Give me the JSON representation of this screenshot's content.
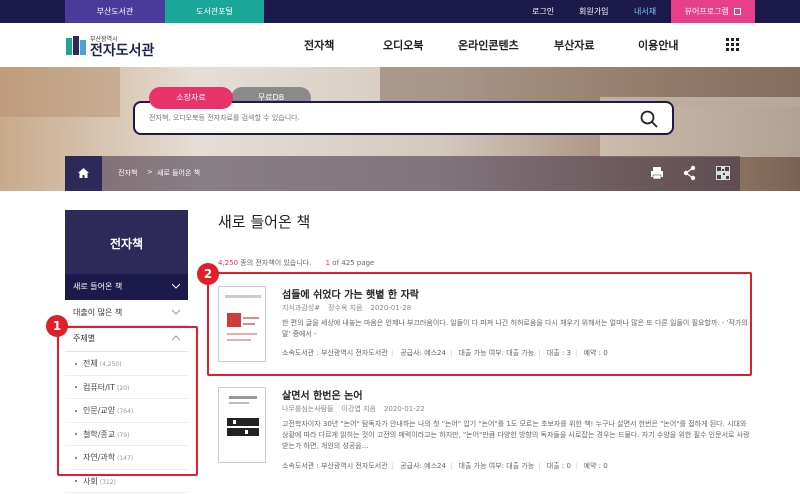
{
  "topbar": {
    "busan_tab": "부산도서관",
    "library_tab": "도서관포털",
    "login": "로그인",
    "join": "회원가입",
    "mylib": "내서재",
    "reader": "뷰어프로그램"
  },
  "logo": {
    "small": "부산광역시",
    "big": "전자도서관"
  },
  "gnb": [
    "전자책",
    "오디오북",
    "온라인콘텐츠",
    "부산자료",
    "이용안내"
  ],
  "search": {
    "tab_holdings": "소장자료",
    "tab_free": "무료DB",
    "placeholder": "전자책, 오디오북등 전자자료를 검색할 수 있습니다."
  },
  "breadcrumb": {
    "level1": "전자책",
    "sep": ">",
    "level2": "새로 들어온 책"
  },
  "sidebar": {
    "title": "전자책",
    "items": [
      {
        "label": "새로 들어온 책"
      },
      {
        "label": "대출이 많은 책"
      },
      {
        "label": "주제별"
      }
    ],
    "subjects": [
      {
        "label": "전체",
        "count": "(4,250)"
      },
      {
        "label": "컴퓨터/IT",
        "count": "(20)"
      },
      {
        "label": "인문/교양",
        "count": "(764)"
      },
      {
        "label": "철학/종교",
        "count": "(79)"
      },
      {
        "label": "자연/과학",
        "count": "(147)"
      },
      {
        "label": "사회",
        "count": "(312)"
      }
    ]
  },
  "main": {
    "title": "새로 들어온 책",
    "count_num": "4,250",
    "count_text": " 종의 전자책이 있습니다.",
    "page_current": "1",
    "page_text": " of 425 page"
  },
  "annotations": {
    "badge1": "1",
    "badge2": "2"
  },
  "books": [
    {
      "title": "섬들에 쉬었다 가는 햇볕 한 자락",
      "author": "지식과감성#",
      "publisher": "장수옥 지음",
      "date": "2020-01-28",
      "desc": "한 편의 글을 세상에 내놓는 마음은 언제나 부끄러움이다. 일들이 다 파져 나간 허허로움을 다시 채우기 위해서는 얼마나 많은 또 다른 일들이 필요할까. - '작가의 말' 중에서 -",
      "holder": "소속도서관 : 부산광역시 전자도서관",
      "supplier": "공급사: 예스24",
      "loanable": "대출 가능 여부: 대출 가능",
      "loans": "대출 : 3",
      "reserve": "예약 : 0"
    },
    {
      "title": "살면서 한번은 논어",
      "author": "나무를심는사람들",
      "publisher": "이강엽 지음",
      "date": "2020-01-22",
      "desc": "고전학자이자 30년 \"논어\" 탐독자가 안내하는 나의 첫 \"논어\" 입기 \"논어\"를 1도 모르는 초보자를 위한 책! 누구나 살면서 한번은 \"논어\"를 접하게 된다. 시대와 상황에 따라 다르게 읽히는 것이 고전의 매력이라고는 하지만, \"논어\"만큼 다양한 방향의 독자들을 사로잡는 경우는 드물다. 자기 수양을 위한 필수 인문서로 사랑받는가 하면, 개인의 성공을...",
      "holder": "소속도서관 : 부산광역시 전자도서관",
      "supplier": "공급사: 예스24",
      "loanable": "대출 가능 여부: 대출 가능",
      "loans": "대출 : 0",
      "reserve": "예약 : 0"
    }
  ]
}
